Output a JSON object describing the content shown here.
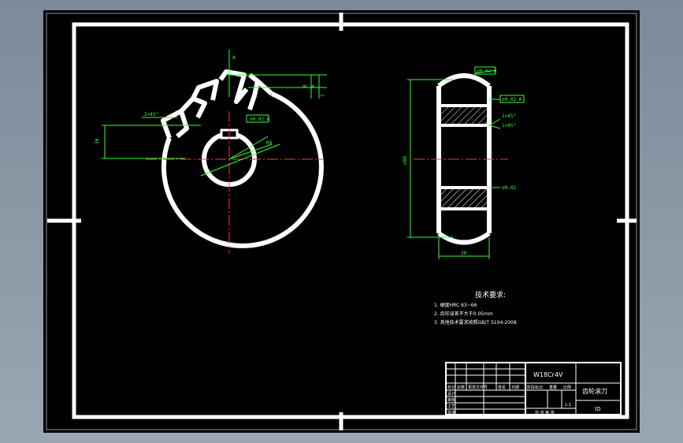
{
  "colors": {
    "background": "#000000",
    "outline": "#ffffff",
    "dimension": "#33ff33",
    "centerline": "#ff3333",
    "frame_outer": "#8c99a6"
  },
  "front_view": {
    "dims": [
      "2×45°",
      "30",
      "8",
      "8",
      "7",
      "R4"
    ],
    "datum_tag": "A",
    "gtol": "⌀0.02 A"
  },
  "side_view": {
    "gtol_top": "⌀0.02 A",
    "gtol_mid": "⌀0.02 A",
    "chamfer_1": "1×45°",
    "chamfer_2": "1×45°",
    "height_dim": "⌀80",
    "width_dim": "20",
    "gtol_lower": "⌀0.02"
  },
  "tech_requirements": {
    "title": "技术要求:",
    "items": [
      "1. 硬度HRC 63~66",
      "2. 齿形误差不大于0.05mm",
      "3. 其他技术要求按照GB/T 5104-2008"
    ]
  },
  "title_block": {
    "material": "W18Cr4V",
    "part_name": "齿轮滚刀",
    "scale": "1:1",
    "code": "ID",
    "row_labels": [
      "标记",
      "处数",
      "更改文件号",
      "签名",
      "日期"
    ],
    "sub_labels": [
      "设计",
      "审核",
      "工艺",
      "批准"
    ],
    "stage_label": "阶段标记",
    "weight_label": "重量",
    "scale_label": "比例",
    "sheet_label": "共 张 第 张"
  }
}
